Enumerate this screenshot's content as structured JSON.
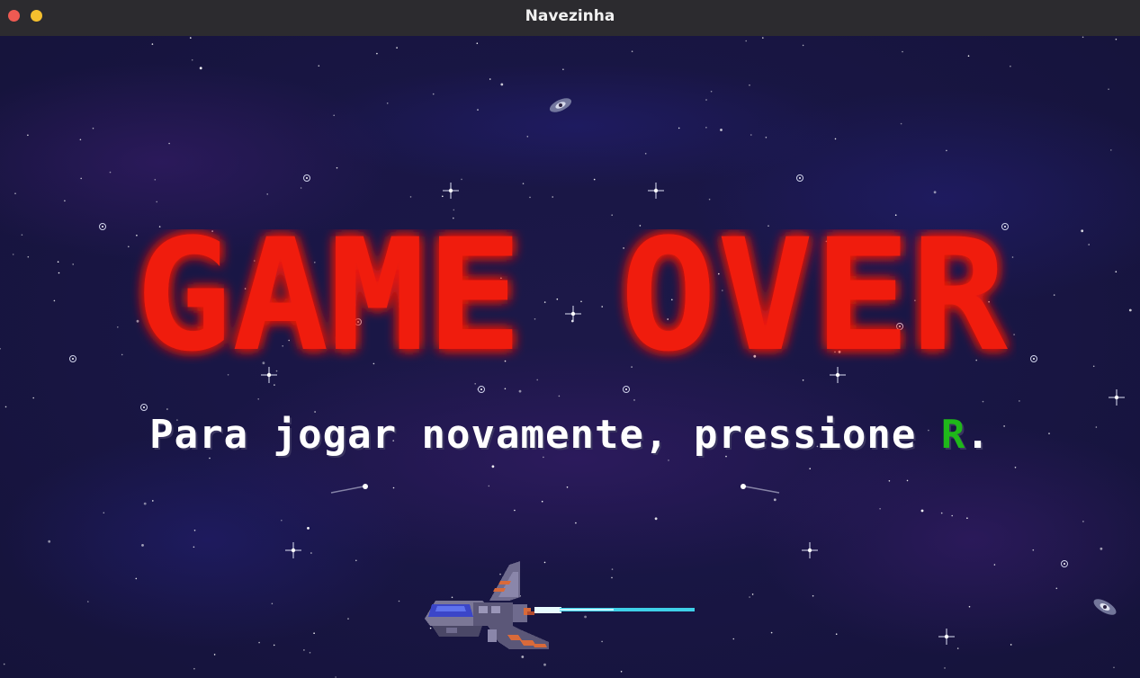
{
  "window": {
    "title": "Navezinha"
  },
  "game": {
    "title": "GAME OVER",
    "restart_prefix": "Para jogar novamente, pressione ",
    "restart_key": "R",
    "restart_suffix": "."
  },
  "colors": {
    "background": "#15133a",
    "title_red": "#f01e0e",
    "title_glow": "#ff3a1a",
    "key_green": "#1fb81a",
    "text_white": "#ffffff",
    "laser": "#3fd0e8"
  },
  "icons": {
    "close": "close-icon",
    "minimize": "minimize-icon",
    "ship": "spaceship-icon",
    "laser": "laser-beam",
    "meteor": "meteor-icon",
    "galaxy": "galaxy-icon"
  }
}
